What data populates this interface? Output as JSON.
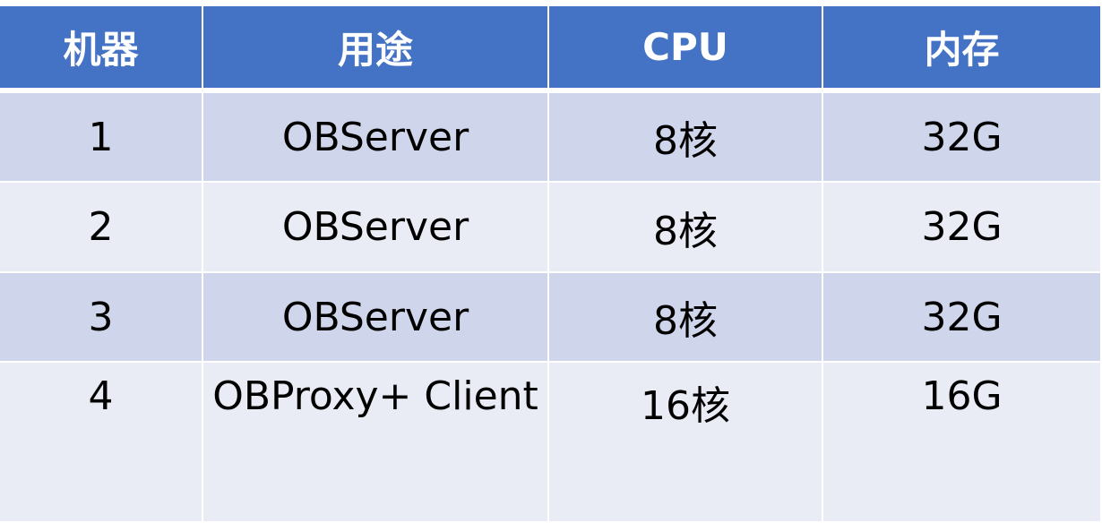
{
  "table": {
    "headers": [
      "机器",
      "用途",
      "CPU",
      "内存"
    ],
    "rows": [
      [
        "1",
        "OBServer",
        "8核",
        "32G"
      ],
      [
        "2",
        "OBServer",
        "8核",
        "32G"
      ],
      [
        "3",
        "OBServer",
        "8核",
        "32G"
      ],
      [
        "4",
        "OBProxy+ Client",
        "16核",
        "16G"
      ]
    ]
  },
  "colors": {
    "header_bg": "#4472c4",
    "header_text": "#ffffff",
    "row_odd_bg": "#cfd5ea",
    "row_even_bg": "#e9ebf5",
    "cell_text": "#000000"
  }
}
